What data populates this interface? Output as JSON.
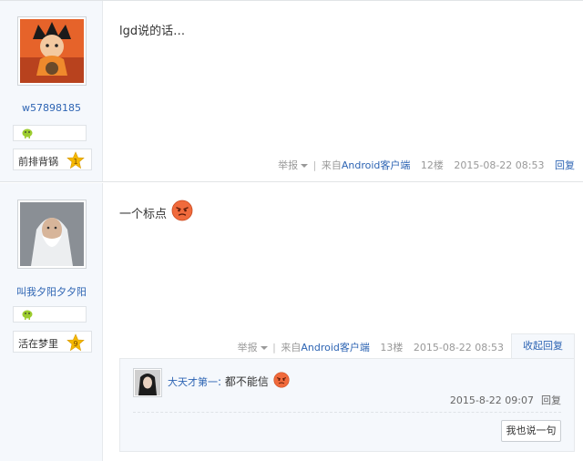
{
  "posts": [
    {
      "username": "w57898185",
      "rank_title": "前排背锅",
      "rank_level": "1",
      "content": "lgd说的话…",
      "tail": {
        "report": "举报",
        "source_prefix": "来自",
        "source_link": "Android客户端",
        "floor": "12楼",
        "time": "2015-08-22 08:53",
        "reply": "回复"
      }
    },
    {
      "username": "叫我夕阳夕夕阳",
      "rank_title": "活在梦里",
      "rank_level": "9",
      "content": "一个标点",
      "tail": {
        "report": "举报",
        "source_prefix": "来自",
        "source_link": "Android客户端",
        "floor": "13楼",
        "time": "2015-08-22 08:53",
        "collapse": "收起回复"
      },
      "sub_reply": {
        "author": "大天才第一",
        "separator": ":",
        "text": "都不能信",
        "time": "2015-8-22 09:07",
        "reply": "回复",
        "button": "我也说一句"
      }
    }
  ],
  "colors": {
    "link": "#2d64b3",
    "sidebar_bg": "#f5f8fc",
    "meta": "#999999",
    "star": "#f5b800"
  },
  "icons": {
    "level_icon": "green-smile-icon",
    "star_icon": "level-star-icon",
    "emoji": "angry-face-emoji-icon",
    "dropdown": "caret-down-icon"
  }
}
